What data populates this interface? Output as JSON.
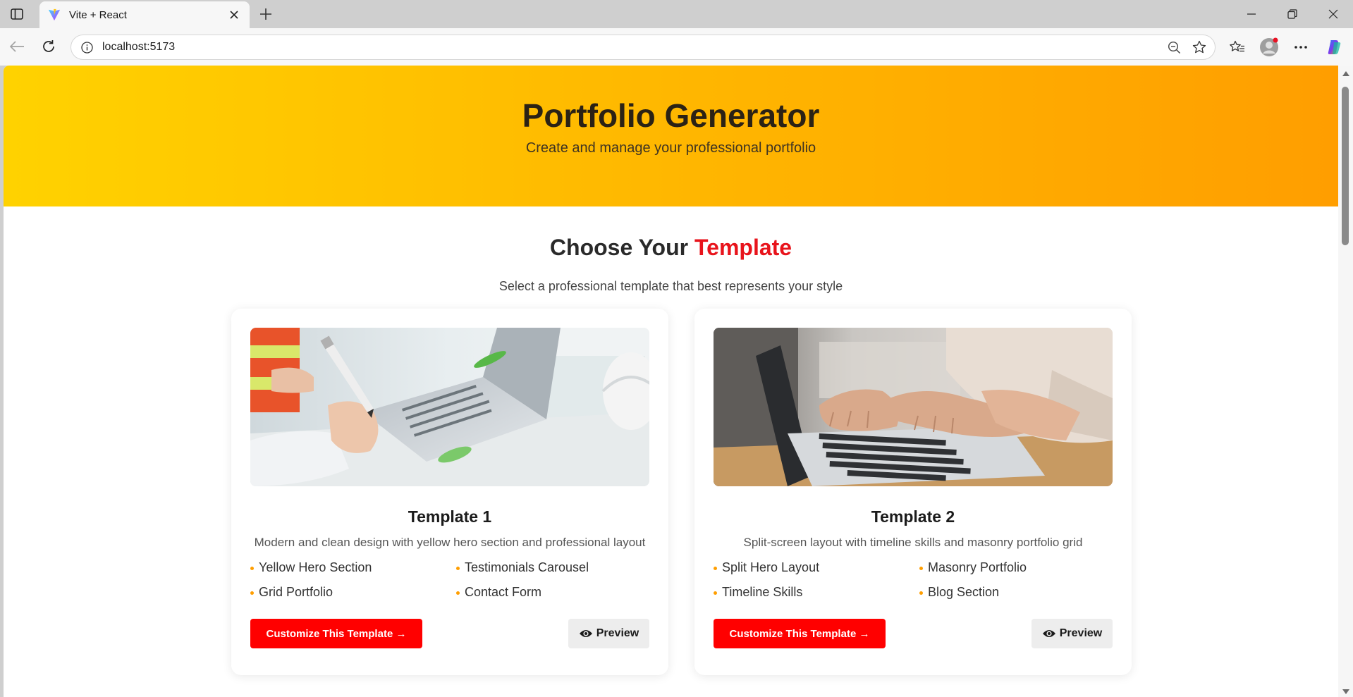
{
  "browser": {
    "tab_title": "Vite + React",
    "url": "localhost:5173",
    "icons": [
      "tab-panel-icon",
      "vite-favicon-icon",
      "close-icon",
      "plus-icon",
      "minimize-icon",
      "restore-icon",
      "close-window-icon",
      "back-arrow-icon",
      "reload-icon",
      "info-icon",
      "zoom-out-icon",
      "star-icon",
      "favorites-icon",
      "profile-icon",
      "more-icon",
      "copilot-icon"
    ]
  },
  "hero": {
    "title": "Portfolio Generator",
    "subtitle": "Create and manage your professional portfolio"
  },
  "section": {
    "title_part1": "Choose Your ",
    "title_accent": "Template",
    "subtitle": "Select a professional template that best represents your style"
  },
  "templates": [
    {
      "title": "Template 1",
      "description": "Modern and clean design with yellow hero section and professional layout",
      "features": [
        "Yellow Hero Section",
        "Testimonials Carousel",
        "Grid Portfolio",
        "Contact Form"
      ],
      "customize_label": "Customize This Template →",
      "preview_label": "Preview"
    },
    {
      "title": "Template 2",
      "description": "Split-screen layout with timeline skills and masonry portfolio grid",
      "features": [
        "Split Hero Layout",
        "Masonry Portfolio",
        "Timeline Skills",
        "Blog Section"
      ],
      "customize_label": "Customize This Template →",
      "preview_label": "Preview"
    }
  ],
  "colors": {
    "accent_red": "#ff0000",
    "hero_yellow": "#ffd200",
    "hero_orange": "#ff9e00",
    "bullet_orange": "#ff9e00"
  }
}
